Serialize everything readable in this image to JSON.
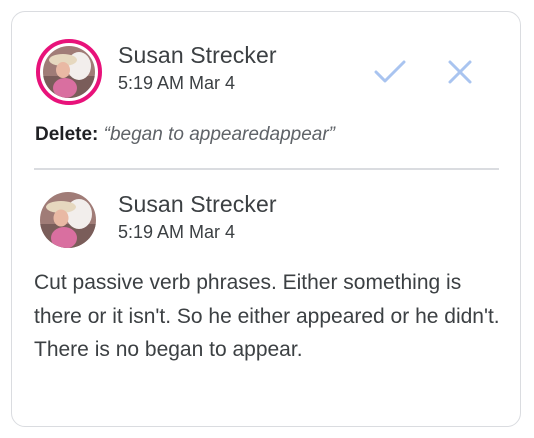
{
  "suggestion": {
    "author": "Susan Strecker",
    "timestamp": "5:19 AM Mar 4",
    "action_label": "Delete:",
    "deleted_text": "“began to appearedappear”",
    "accept_icon": "checkmark-icon",
    "reject_icon": "close-icon"
  },
  "reply": {
    "author": "Susan Strecker",
    "timestamp": "5:19 AM Mar 4",
    "body": "Cut passive verb phrases. Either something is there or it isn't. So he either appeared or he didn't. There is no began to appear."
  },
  "colors": {
    "avatar_ring": "#e8127a",
    "action_icon": "#a9c4f0"
  }
}
